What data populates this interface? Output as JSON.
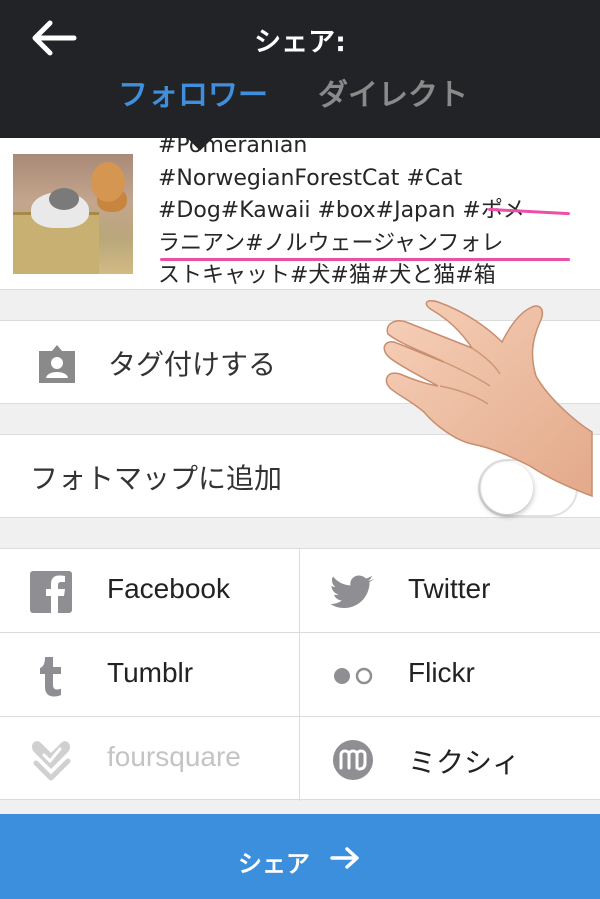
{
  "header": {
    "title": "シェア:",
    "tabs": [
      {
        "label": "フォロワー",
        "active": true
      },
      {
        "label": "ダイレクト",
        "active": false
      }
    ]
  },
  "caption": {
    "lines": [
      "#Pomeranian",
      "#NorwegianForestCat #Cat",
      "#Dog#Kawaii #box#Japan #ポメ",
      "ラニアン#ノルウェージャンフォレ",
      "ストキャット#犬#猫#犬と猫#箱"
    ]
  },
  "options": {
    "tag_people": "タグ付けする",
    "add_to_photo_map": "フォトマップに追加",
    "photo_map_enabled": false
  },
  "share_targets": [
    {
      "label": "Facebook",
      "icon": "facebook-icon",
      "enabled": true
    },
    {
      "label": "Twitter",
      "icon": "twitter-icon",
      "enabled": true
    },
    {
      "label": "Tumblr",
      "icon": "tumblr-icon",
      "enabled": true
    },
    {
      "label": "Flickr",
      "icon": "flickr-icon",
      "enabled": true
    },
    {
      "label": "foursquare",
      "icon": "foursquare-icon",
      "enabled": false
    },
    {
      "label": "ミクシィ",
      "icon": "mixi-icon",
      "enabled": true
    }
  ],
  "share_button": {
    "label": "シェア"
  },
  "colors": {
    "header_bg": "#222327",
    "accent": "#3b8fdc",
    "highlight": "#ec4fa8"
  }
}
